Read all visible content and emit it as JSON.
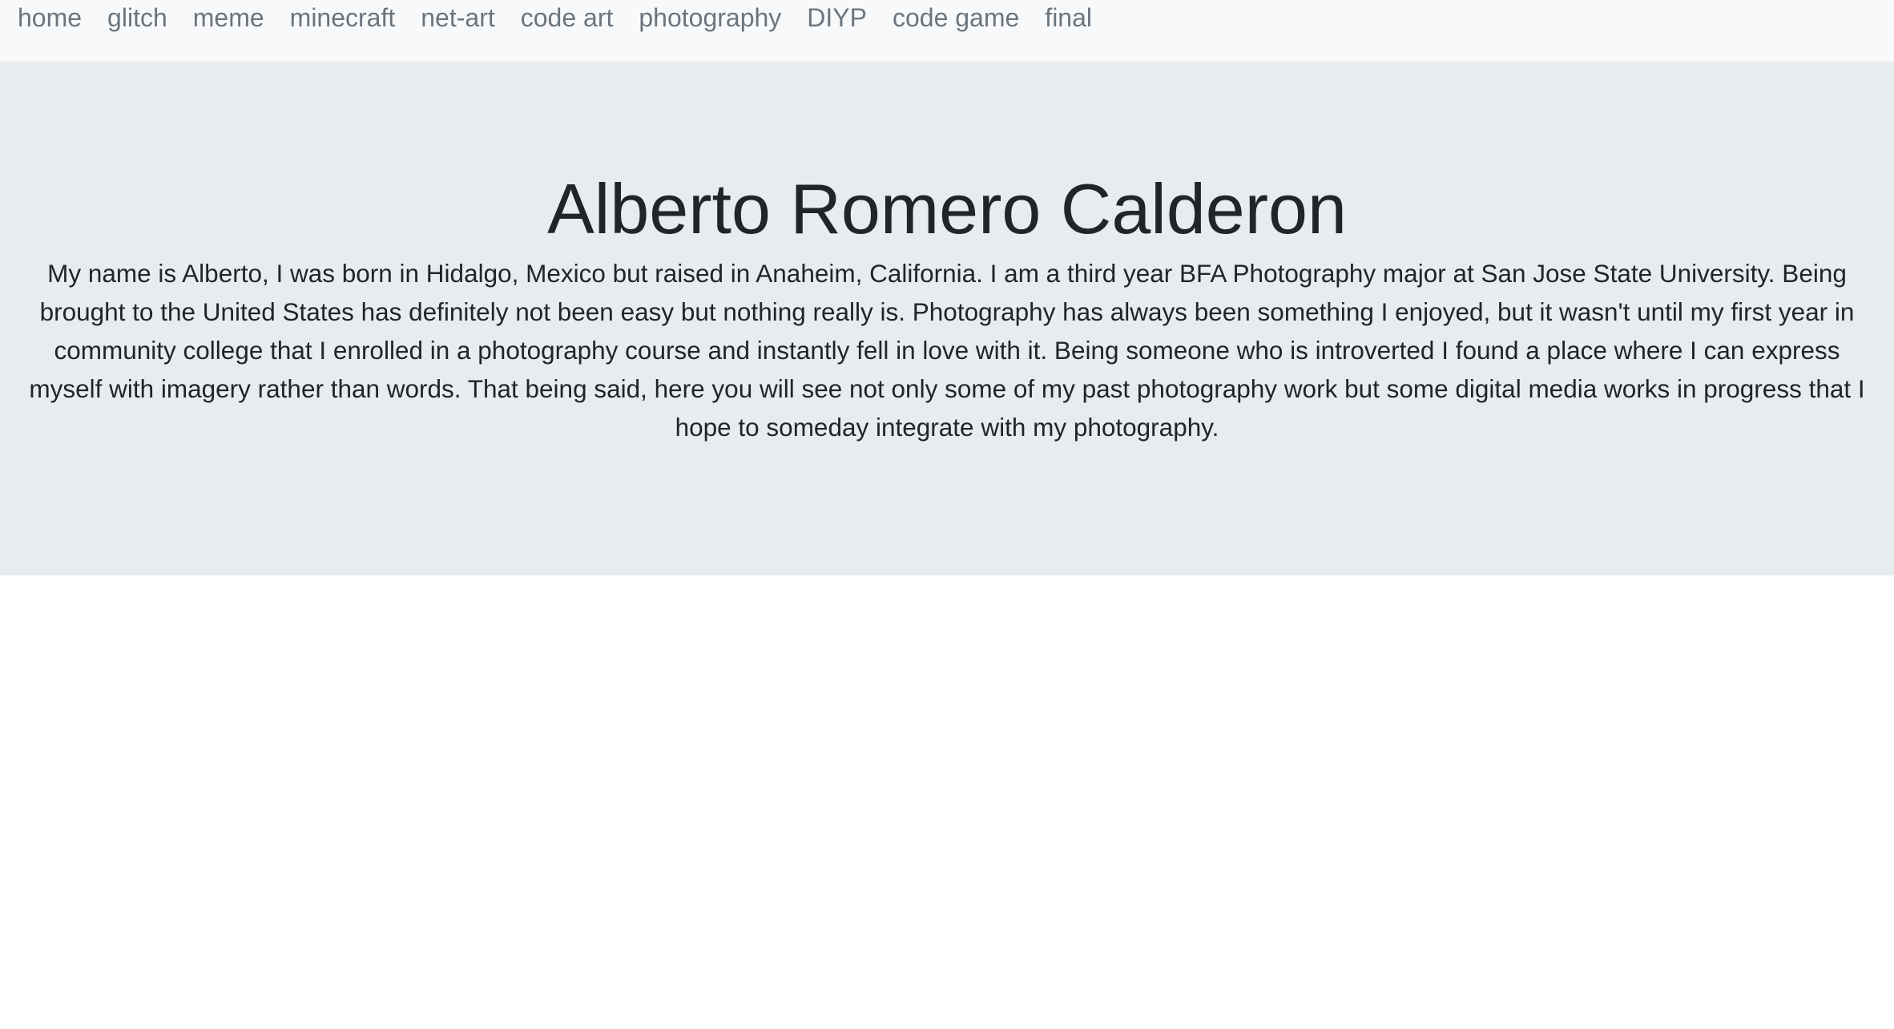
{
  "nav": {
    "items": [
      {
        "label": "home"
      },
      {
        "label": "glitch"
      },
      {
        "label": "meme"
      },
      {
        "label": "minecraft"
      },
      {
        "label": "net-art"
      },
      {
        "label": "code art"
      },
      {
        "label": "photography"
      },
      {
        "label": "DIYP"
      },
      {
        "label": "code game"
      },
      {
        "label": "final"
      }
    ]
  },
  "hero": {
    "title": "Alberto Romero Calderon",
    "bio": "My name is Alberto, I was born in Hidalgo, Mexico but raised in Anaheim, California. I am a third year BFA Photography major at San Jose State University. Being brought to the United States has definitely not been easy but nothing really is. Photography has always been something I enjoyed, but it wasn't until my first year in community college that I enrolled in a photography course and instantly fell in love with it. Being someone who is introverted I found a place where I can express myself with imagery rather than words. That being said, here you will see not only some of my past photography work but some digital media works in progress that I hope to someday integrate with my photography."
  },
  "colors": {
    "navbar_bg": "#f8f9fa",
    "nav_link": "#6c757d",
    "jumbotron_bg": "#e9ecef",
    "text": "#212529"
  }
}
